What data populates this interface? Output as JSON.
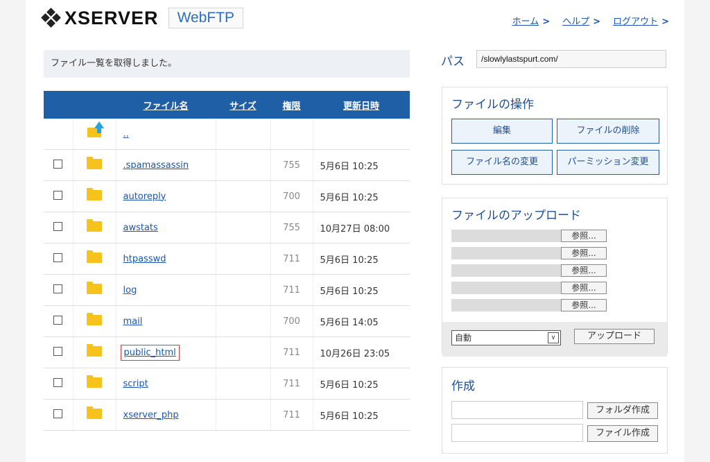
{
  "header": {
    "logo_text": "XSERVER",
    "logo_sub": "WebFTP",
    "nav": [
      {
        "label": "ホーム",
        "chevron": ">"
      },
      {
        "label": "ヘルプ",
        "chevron": ">"
      },
      {
        "label": "ログアウト",
        "chevron": ">"
      }
    ]
  },
  "status_message": "ファイル一覧を取得しました。",
  "path": {
    "label": "パス",
    "value": "/slowlylastspurt.com/"
  },
  "table": {
    "headers": {
      "name": "ファイル名",
      "size": "サイズ",
      "perm": "権限",
      "date": "更新日時"
    },
    "parent": "..",
    "rows": [
      {
        "name": ".spamassassin",
        "perm": "755",
        "date": "5月6日 10:25"
      },
      {
        "name": "autoreply",
        "perm": "700",
        "date": "5月6日 10:25"
      },
      {
        "name": "awstats",
        "perm": "755",
        "date": "10月27日 08:00"
      },
      {
        "name": "htpasswd",
        "perm": "711",
        "date": "5月6日 10:25"
      },
      {
        "name": "log",
        "perm": "711",
        "date": "5月6日 10:25"
      },
      {
        "name": "mail",
        "perm": "700",
        "date": "5月6日 14:05"
      },
      {
        "name": "public_html",
        "perm": "711",
        "date": "10月26日 23:05",
        "highlighted": true
      },
      {
        "name": "script",
        "perm": "711",
        "date": "5月6日 10:25"
      },
      {
        "name": "xserver_php",
        "perm": "711",
        "date": "5月6日 10:25"
      }
    ]
  },
  "operations": {
    "title": "ファイルの操作",
    "edit": "編集",
    "delete": "ファイルの削除",
    "rename": "ファイル名の変更",
    "permission": "パーミッション変更"
  },
  "upload": {
    "title": "ファイルのアップロード",
    "browse_label": "参照...",
    "mode_value": "自動",
    "mode_arrow": "∨",
    "upload_button": "アップロード"
  },
  "create": {
    "title": "作成",
    "folder_button": "フォルダ作成",
    "file_button": "ファイル作成"
  },
  "colors": {
    "header_bar": "#1f5fa6",
    "link": "#1a55b0",
    "folder": "#f8c21c",
    "accent_title": "#1d4f96"
  }
}
